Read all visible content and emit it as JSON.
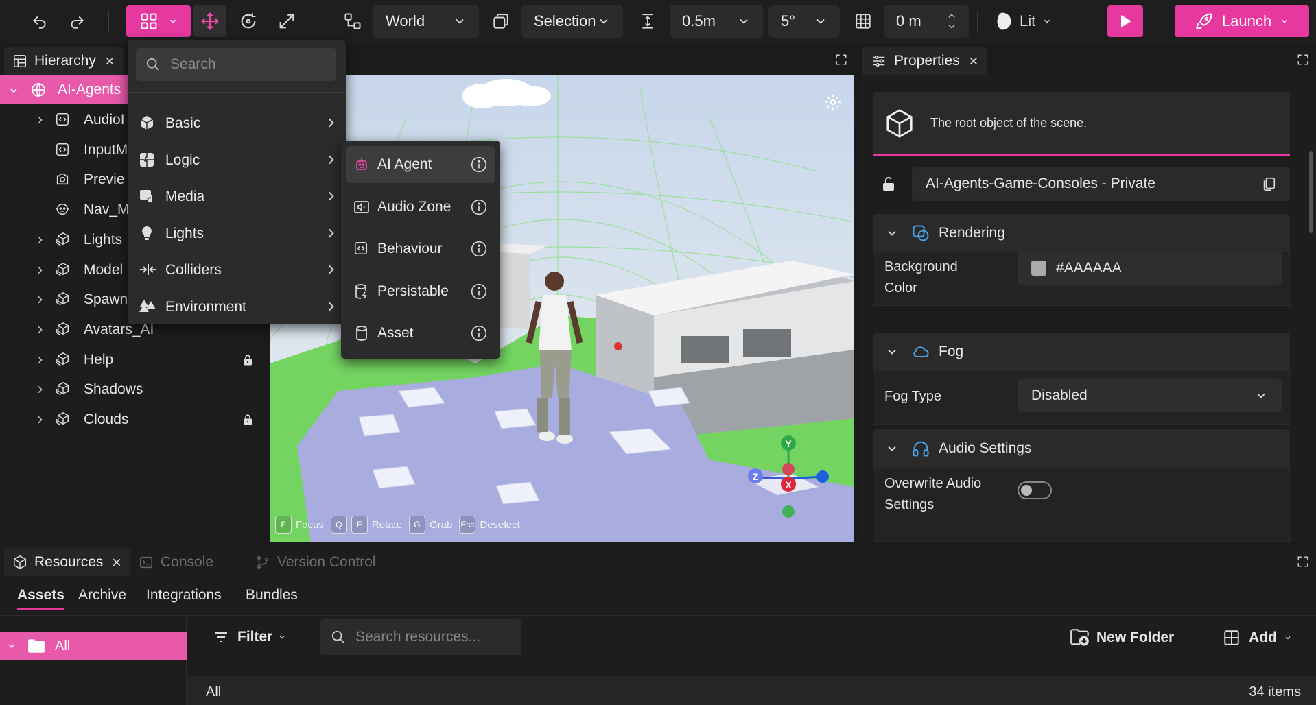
{
  "colors": {
    "accent": "#e6389f",
    "selection": "#e859aa",
    "panel": "#1d1d1d"
  },
  "toolbar": {
    "coordinate_space": "World",
    "pivot_mode": "Selection",
    "snap_distance": "0.5m",
    "snap_angle": "5°",
    "grid_height": "0 m",
    "lighting_mode": "Lit",
    "launch_label": "Launch"
  },
  "panels": {
    "hierarchy_tab": "Hierarchy",
    "properties_tab": "Properties",
    "resources_tab": "Resources",
    "console_tab": "Console",
    "version_control_tab": "Version Control"
  },
  "hierarchy": {
    "root": "AI-Agents",
    "items": [
      {
        "label": "AudioI",
        "icon": "script-icon",
        "expandable": true,
        "locked": false
      },
      {
        "label": "InputM",
        "icon": "script-icon",
        "expandable": false,
        "locked": false
      },
      {
        "label": "Previe",
        "icon": "camera-icon",
        "expandable": false,
        "locked": false
      },
      {
        "label": "Nav_M",
        "icon": "agent-icon",
        "expandable": false,
        "locked": false
      },
      {
        "label": "Lights",
        "icon": "cube-group-icon",
        "expandable": true,
        "locked": false
      },
      {
        "label": "Model",
        "icon": "cube-group-icon",
        "expandable": true,
        "locked": false
      },
      {
        "label": "Spawn",
        "icon": "cube-group-icon",
        "expandable": true,
        "locked": false
      },
      {
        "label": "Avatars_AI",
        "icon": "cube-group-icon",
        "expandable": true,
        "locked": false
      },
      {
        "label": "Help",
        "icon": "cube-group-icon",
        "expandable": true,
        "locked": true
      },
      {
        "label": "Shadows",
        "icon": "cube-group-icon",
        "expandable": true,
        "locked": false
      },
      {
        "label": "Clouds",
        "icon": "cube-group-icon",
        "expandable": true,
        "locked": true
      }
    ]
  },
  "add_menu": {
    "search_placeholder": "Search",
    "items": [
      {
        "label": "Basic",
        "icon": "cube-icon"
      },
      {
        "label": "Logic",
        "icon": "puzzle-icon"
      },
      {
        "label": "Media",
        "icon": "media-icon"
      },
      {
        "label": "Lights",
        "icon": "bulb-icon"
      },
      {
        "label": "Colliders",
        "icon": "collider-icon"
      },
      {
        "label": "Environment",
        "icon": "trees-icon"
      }
    ]
  },
  "logic_submenu": {
    "items": [
      {
        "label": "AI Agent",
        "icon": "robot-icon",
        "highlighted": true
      },
      {
        "label": "Audio Zone",
        "icon": "audio-zone-icon",
        "highlighted": false
      },
      {
        "label": "Behaviour",
        "icon": "script-icon",
        "highlighted": false
      },
      {
        "label": "Persistable",
        "icon": "persist-icon",
        "highlighted": false
      },
      {
        "label": "Asset",
        "icon": "asset-icon",
        "highlighted": false
      }
    ]
  },
  "viewport": {
    "hints": [
      {
        "key": "F",
        "action": "Focus"
      },
      {
        "key": "Q",
        "action": ""
      },
      {
        "key": "E",
        "action": "Rotate"
      },
      {
        "key": "G",
        "action": "Grab"
      },
      {
        "key": "Esc",
        "action": "Deselect"
      }
    ],
    "gizmo": {
      "y": "Y",
      "z": "Z",
      "x": "X"
    }
  },
  "properties": {
    "description": "The root object of the scene.",
    "object_path": "AI-Agents-Game-Consoles - Private",
    "rendering": {
      "title": "Rendering",
      "background_color_label_1": "Background",
      "background_color_label_2": "Color",
      "background_color_value": "#AAAAAA"
    },
    "fog": {
      "title": "Fog",
      "fog_type_label": "Fog Type",
      "fog_type_value": "Disabled"
    },
    "audio": {
      "title": "Audio Settings",
      "overwrite_label_1": "Overwrite Audio",
      "overwrite_label_2": "Settings",
      "overwrite_enabled": false
    }
  },
  "resources": {
    "subtabs": [
      "Assets",
      "Archive",
      "Integrations",
      "Bundles"
    ],
    "folder_all": "All",
    "filter_label": "Filter",
    "search_placeholder": "Search resources...",
    "new_folder_label": "New Folder",
    "add_label": "Add",
    "list_title": "All",
    "item_count": "34 items"
  }
}
